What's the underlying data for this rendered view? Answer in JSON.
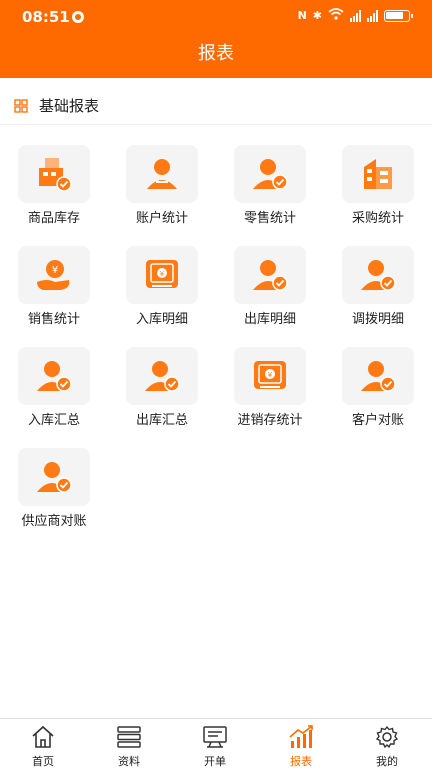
{
  "status_bar": {
    "time": "08:51"
  },
  "title": "报表",
  "section": {
    "title": "基础报表"
  },
  "tiles": [
    {
      "label": "商品库存",
      "icon": "warehouse-icon"
    },
    {
      "label": "账户统计",
      "icon": "account-icon"
    },
    {
      "label": "零售统计",
      "icon": "retail-icon"
    },
    {
      "label": "采购统计",
      "icon": "purchase-icon"
    },
    {
      "label": "销售统计",
      "icon": "sales-icon"
    },
    {
      "label": "入库明细",
      "icon": "stock-in-detail-icon"
    },
    {
      "label": "出库明细",
      "icon": "stock-out-detail-icon"
    },
    {
      "label": "调拨明细",
      "icon": "transfer-detail-icon"
    },
    {
      "label": "入库汇总",
      "icon": "stock-in-summary-icon"
    },
    {
      "label": "出库汇总",
      "icon": "stock-out-summary-icon"
    },
    {
      "label": "进销存统计",
      "icon": "inventory-stats-icon"
    },
    {
      "label": "客户对账",
      "icon": "customer-reconcile-icon"
    },
    {
      "label": "供应商对账",
      "icon": "supplier-reconcile-icon"
    }
  ],
  "nav": [
    {
      "label": "首页",
      "icon": "home-icon"
    },
    {
      "label": "资料",
      "icon": "data-icon"
    },
    {
      "label": "开单",
      "icon": "billing-icon"
    },
    {
      "label": "报表",
      "icon": "report-icon",
      "active": true
    },
    {
      "label": "我的",
      "icon": "settings-icon"
    }
  ],
  "colors": {
    "accent": "#ff6a00",
    "tile_bg": "#f4f4f4"
  }
}
